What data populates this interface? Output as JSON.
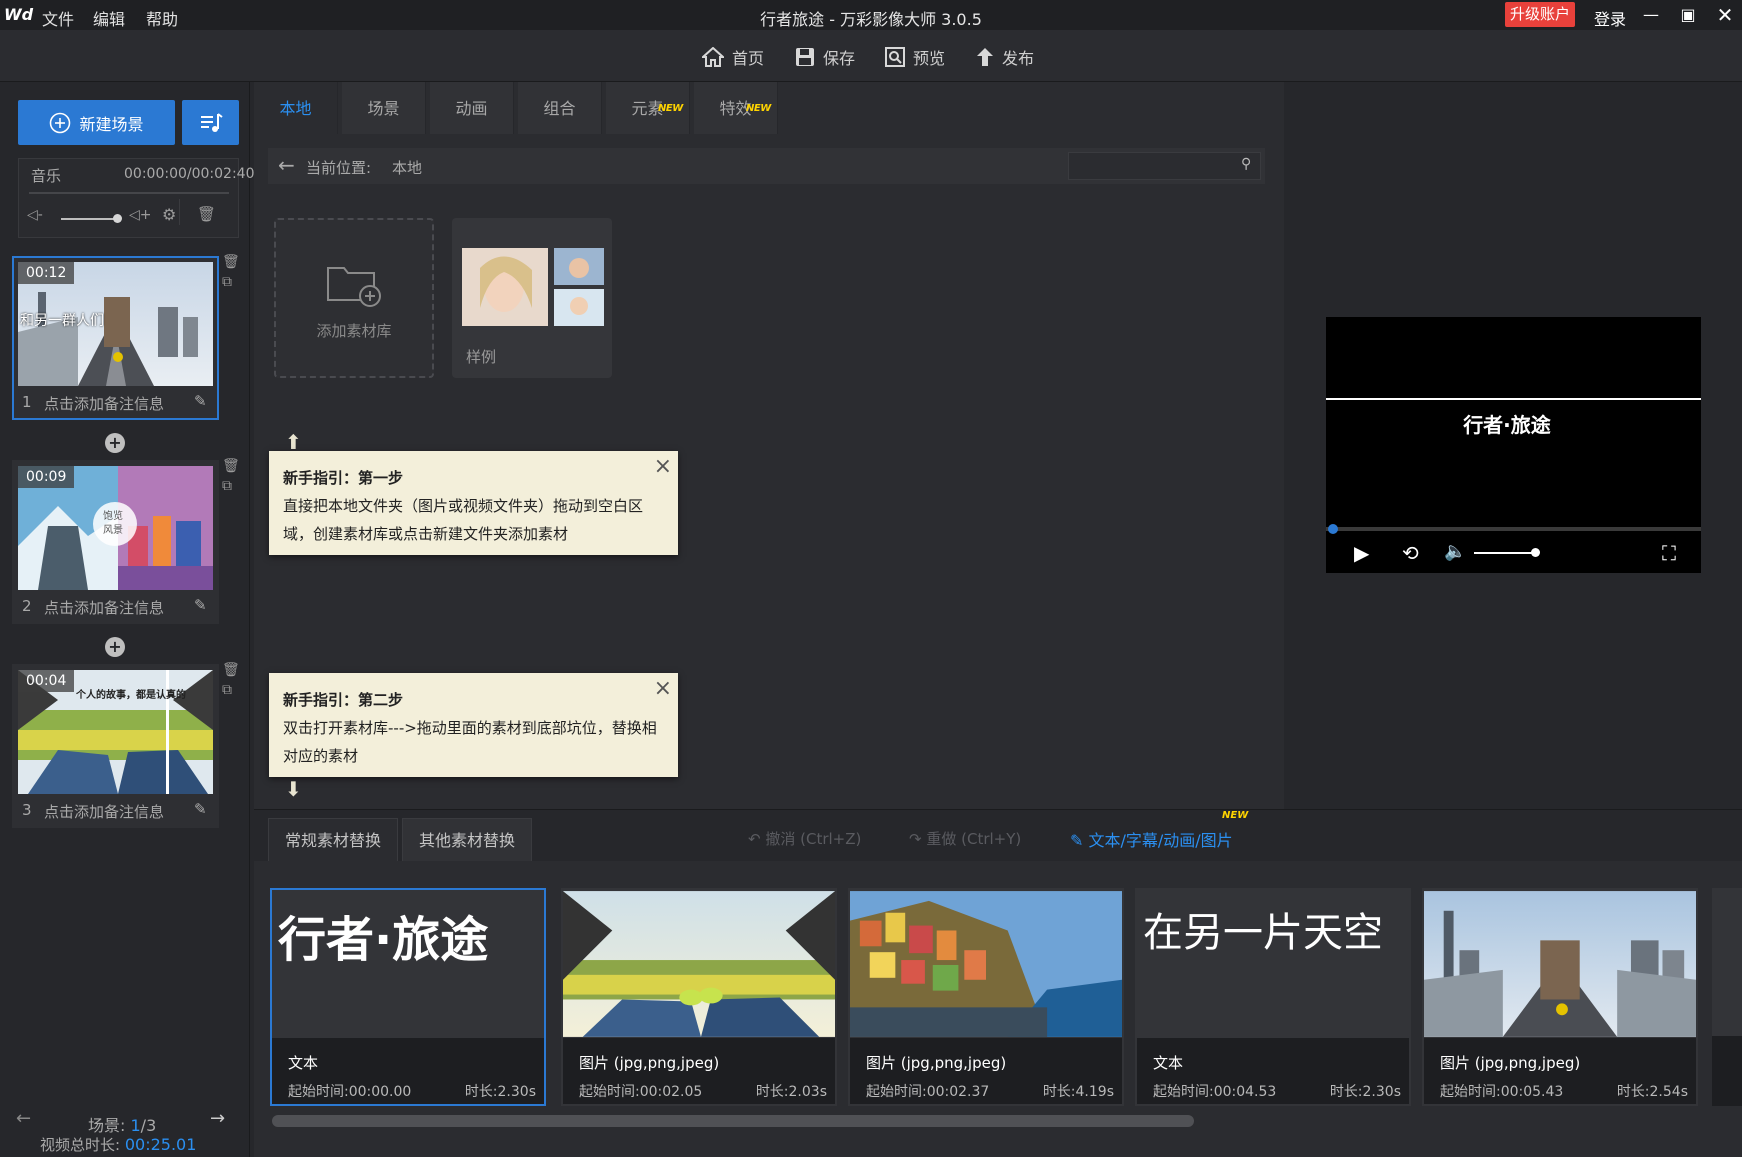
{
  "app": {
    "logo": "Wd",
    "title": "行者旅途 - 万彩影像大师 3.0.5",
    "menu": [
      "文件",
      "编辑",
      "帮助"
    ],
    "upgrade_label": "升级账户",
    "login_label": "登录"
  },
  "toolbar": {
    "home": "首页",
    "save": "保存",
    "preview": "预览",
    "publish": "发布"
  },
  "left": {
    "new_scene": "新建场景",
    "music_label": "音乐",
    "music_time": "00:00:00/00:02:40",
    "scenes": [
      {
        "index": "1",
        "time": "00:12",
        "note": "点击添加备注信息",
        "overlay": "和另一群人们"
      },
      {
        "index": "2",
        "time": "00:09",
        "note": "点击添加备注信息",
        "overlay": "饱览风景"
      },
      {
        "index": "3",
        "time": "00:04",
        "note": "点击添加备注信息",
        "overlay": "个人的故事，都是认真的"
      }
    ],
    "scene_label": "场景: ",
    "scene_current": "1",
    "scene_sep": "/",
    "scene_total": "3",
    "total_label": "视频总时长: ",
    "total_time": "00:25.01"
  },
  "tabs": [
    {
      "label": "本地",
      "new": false,
      "new_text": ""
    },
    {
      "label": "场景",
      "new": false,
      "new_text": ""
    },
    {
      "label": "动画",
      "new": false,
      "new_text": ""
    },
    {
      "label": "组合",
      "new": false,
      "new_text": ""
    },
    {
      "label": "元素",
      "new": true,
      "new_text": "NEW"
    },
    {
      "label": "特效",
      "new": true,
      "new_text": "NEW"
    }
  ],
  "path": {
    "label": "当前位置:",
    "value": "本地",
    "search_placeholder": ""
  },
  "library": {
    "add_label": "添加素材库",
    "sample_label": "样例"
  },
  "guides": [
    {
      "title": "新手指引：第一步",
      "body": "直接把本地文件夹（图片或视频文件夹）拖动到空白区域，创建素材库或点击新建文件夹添加素材"
    },
    {
      "title": "新手指引：第二步",
      "body": "双击打开素材库--->拖动里面的素材到底部坑位，替换相对应的素材"
    }
  ],
  "player": {
    "caption": "行者·旅途"
  },
  "bottom": {
    "tab_regular": "常规素材替换",
    "tab_other": "其他素材替换",
    "undo": "撤消 (Ctrl+Z)",
    "redo": "重做 (Ctrl+Y)",
    "text_link": "文本/字幕/动画/图片",
    "text_link_new": "NEW"
  },
  "cards": [
    {
      "kind": "text",
      "content": "行者·旅途",
      "type": "文本",
      "start": "起始时间:00:00.00",
      "duration": "时长:2.30s"
    },
    {
      "kind": "image",
      "content": "",
      "type": "图片 (jpg,png,jpeg)",
      "start": "起始时间:00:02.05",
      "duration": "时长:2.03s"
    },
    {
      "kind": "image",
      "content": "",
      "type": "图片 (jpg,png,jpeg)",
      "start": "起始时间:00:02.37",
      "duration": "时长:4.19s"
    },
    {
      "kind": "text",
      "content": "在另一片天空",
      "type": "文本",
      "start": "起始时间:00:04.53",
      "duration": "时长:2.30s"
    },
    {
      "kind": "image",
      "content": "",
      "type": "图片 (jpg,png,jpeg)",
      "start": "起始时间:00:05.43",
      "duration": "时长:2.54s"
    }
  ],
  "colors": {
    "accent": "#2b79d3",
    "upgrade": "#e8413b",
    "new_badge": "#ffd400"
  }
}
